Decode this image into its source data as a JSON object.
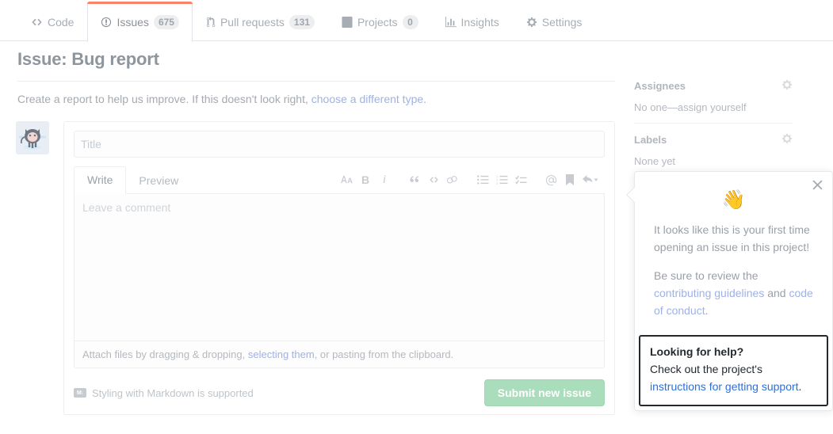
{
  "repo_nav": {
    "tabs": [
      {
        "label": "Code",
        "icon": "code-icon",
        "count": null,
        "selected": false
      },
      {
        "label": "Issues",
        "icon": "issue-opened-icon",
        "count": "675",
        "selected": true
      },
      {
        "label": "Pull requests",
        "icon": "git-pull-request-icon",
        "count": "131",
        "selected": false
      },
      {
        "label": "Projects",
        "icon": "project-icon",
        "count": "0",
        "selected": false
      },
      {
        "label": "Insights",
        "icon": "graph-icon",
        "count": null,
        "selected": false
      },
      {
        "label": "Settings",
        "icon": "gear-icon",
        "count": null,
        "selected": false
      }
    ]
  },
  "page": {
    "title": "Issue: Bug report",
    "subtext_before": "Create a report to help us improve. If this doesn't look right, ",
    "subtext_link": "choose a different type",
    "subtext_after": "."
  },
  "composer": {
    "title_placeholder": "Title",
    "title_value": "",
    "write_tab": "Write",
    "preview_tab": "Preview",
    "comment_placeholder": "Leave a comment",
    "comment_value": "",
    "toolbar": [
      {
        "name": "heading-icon",
        "label": "AA"
      },
      {
        "name": "bold-icon",
        "label": "B"
      },
      {
        "name": "italic-icon",
        "label": "i"
      },
      {
        "name": "quote-icon",
        "label": "“"
      },
      {
        "name": "code-icon",
        "label": "<>"
      },
      {
        "name": "link-icon",
        "label": "link"
      },
      {
        "name": "unordered-list-icon",
        "label": "list"
      },
      {
        "name": "ordered-list-icon",
        "label": "1. list"
      },
      {
        "name": "task-list-icon",
        "label": "task list"
      },
      {
        "name": "mention-icon",
        "label": "@"
      },
      {
        "name": "saved-reply-icon",
        "label": "bookmark"
      },
      {
        "name": "reply-icon",
        "label": "reply"
      }
    ],
    "dropzone_before": "Attach files by dragging & dropping, ",
    "dropzone_link": "selecting them",
    "dropzone_after": ", or pasting from the clipboard.",
    "markdown_badge": "M↓",
    "markdown_note": "Styling with Markdown is supported",
    "submit_label": "Submit new issue",
    "submit_disabled_color": "#a9ddbb"
  },
  "sidebar": {
    "assignees": {
      "heading": "Assignees",
      "gear": "gear-icon",
      "value": "No one—assign yourself"
    },
    "labels": {
      "heading": "Labels",
      "gear": "gear-icon",
      "value": "None yet"
    }
  },
  "popup": {
    "close": "×",
    "emoji": "👋",
    "paragraph1": "It looks like this is your first time opening an issue in this project!",
    "p2_before": "Be sure to review the ",
    "p2_link1": "contributing guidelines",
    "p2_mid": " and ",
    "p2_link2": "code of conduct",
    "p2_after": ".",
    "help_title": "Looking for help?",
    "help_before": "Check out the project's ",
    "help_link": "instructions for getting support",
    "help_after": "."
  },
  "colors": {
    "accent_orange": "#f9826c",
    "link_blue": "#2f6fd9",
    "muted_link": "#9fb2e7",
    "submit_green": "#a9ddbb"
  }
}
